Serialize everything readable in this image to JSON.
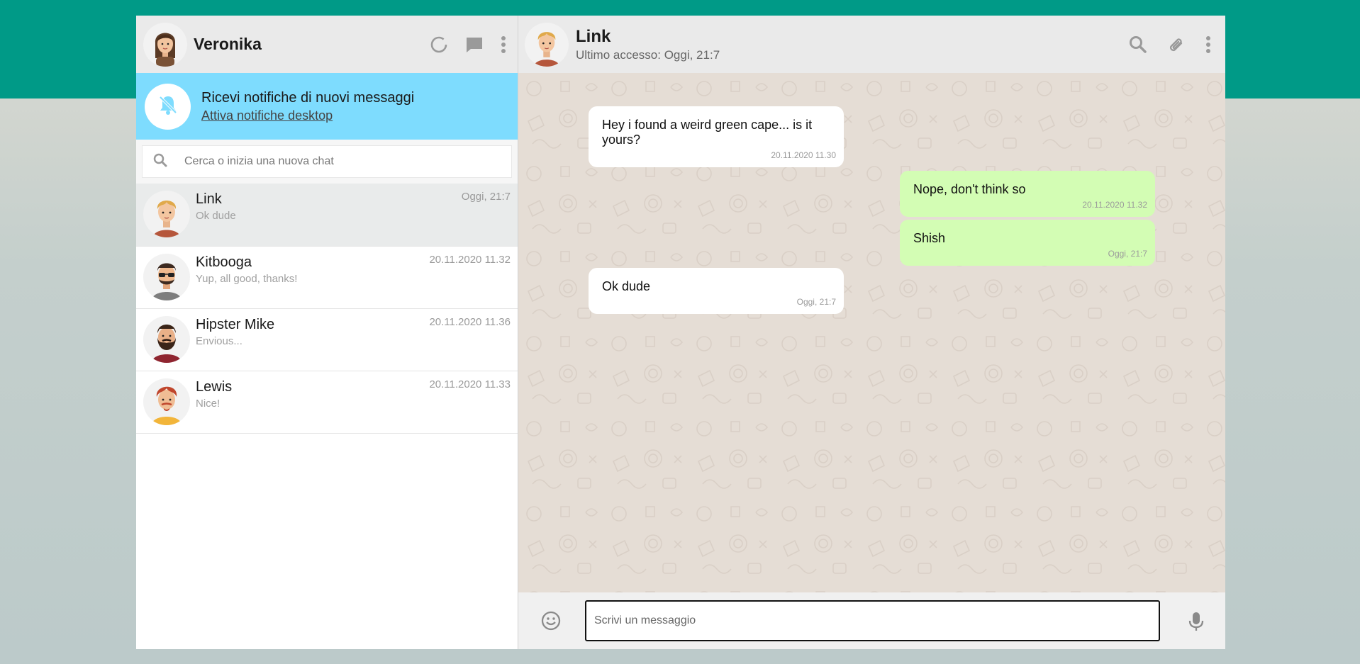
{
  "me": {
    "name": "Veronika"
  },
  "notification": {
    "title": "Ricevi notifiche di nuovi messaggi",
    "link": "Attiva notifiche desktop"
  },
  "search": {
    "placeholder": "Cerca o inizia una nuova chat"
  },
  "chats": [
    {
      "name": "Link",
      "preview": "Ok dude",
      "time": "Oggi, 21:7",
      "active": true
    },
    {
      "name": "Kitbooga",
      "preview": "Yup, all good, thanks!",
      "time": "20.11.2020 11.32"
    },
    {
      "name": "Hipster Mike",
      "preview": "Envious...",
      "time": "20.11.2020 11.36"
    },
    {
      "name": "Lewis",
      "preview": "Nice!",
      "time": "20.11.2020 11.33"
    }
  ],
  "active_chat": {
    "name": "Link",
    "last_seen": "Ultimo accesso: Oggi, 21:7",
    "messages": [
      {
        "direction": "in",
        "text": "Hey i found a weird green cape... is it yours?",
        "time": "20.11.2020 11.30"
      },
      {
        "direction": "out",
        "text": "Nope, don't think so",
        "time": "20.11.2020 11.32"
      },
      {
        "direction": "out",
        "text": "Shish",
        "time": "Oggi, 21:7"
      },
      {
        "direction": "in",
        "text": "Ok dude",
        "time": "Oggi, 21:7"
      }
    ]
  },
  "composer": {
    "placeholder": "Scrivi un messaggio"
  },
  "colors": {
    "brand_band": "#009a87",
    "notify_bg": "#7edcfe",
    "incoming_bubble": "#ffffff",
    "outgoing_bubble": "#d3fdb4",
    "chat_bg": "#e5ddd5"
  },
  "icons": {
    "sidebar_header": [
      "status-icon",
      "new-chat-icon",
      "menu-icon"
    ],
    "chat_header": [
      "search-icon",
      "attach-icon",
      "menu-icon"
    ],
    "notify": "bell-off-icon",
    "composer": [
      "emoji-icon",
      "mic-icon"
    ]
  }
}
